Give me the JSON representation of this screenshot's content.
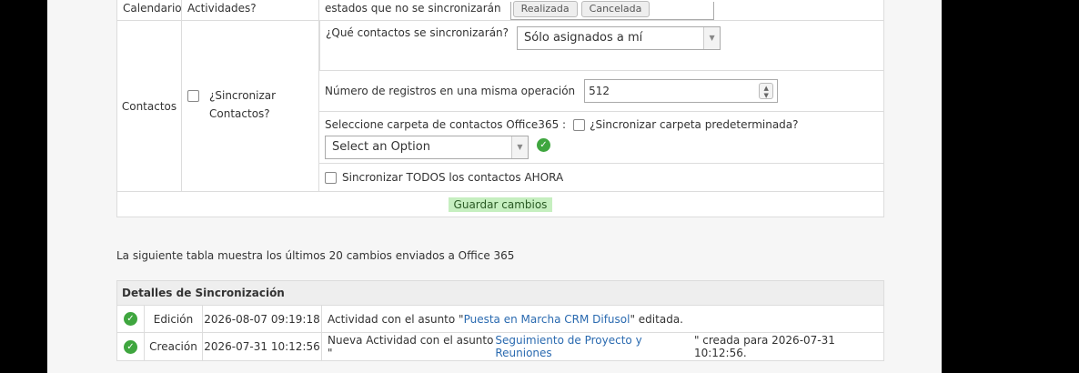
{
  "calendar_row": {
    "label": "Calendario",
    "sync_label": "Actividades?",
    "states_label": "estados que no se sincronizarán",
    "state_chips": [
      "Realizada",
      "Cancelada"
    ]
  },
  "contacts": {
    "label": "Contactos",
    "sync_label": "¿Sincronizar Contactos?",
    "which_label": "¿Qué contactos se sincronizarán?",
    "which_value": "Sólo asignados a mí",
    "records_label": "Número de registros en una misma operación",
    "records_value": "512",
    "folder_label": "Seleccione carpeta de contactos Office365 :",
    "default_folder_label": "¿Sincronizar carpeta predeterminada?",
    "folder_select": "Select an Option",
    "sync_all_label": "Sincronizar TODOS los contactos AHORA"
  },
  "save_label": "Guardar cambios",
  "note": "La siguiente tabla muestra los últimos 20 cambios enviados a Office 365",
  "history": {
    "title": "Detalles de Sincronización",
    "rows": [
      {
        "type": "Edición",
        "date": "2026-08-07 09:19:18",
        "pre": "Actividad con el asunto \"",
        "link": "Puesta en Marcha CRM Difusol",
        "post": "\" editada."
      },
      {
        "type": "Creación",
        "date": "2026-07-31 10:12:56",
        "pre": "Nueva Actividad con el asunto \"",
        "link": "Seguimiento de Proyecto y Reuniones",
        "post": "\" creada para 2026-07-31 10:12:56."
      }
    ]
  },
  "icons": {
    "success": "check-circle-icon",
    "select_arrow": "triangle-down-icon",
    "spinner": "up-down-chevron-icon"
  },
  "colors": {
    "success_green": "#3fa63f",
    "save_bg": "#c6efc0",
    "link_blue": "#2a6ab0"
  }
}
